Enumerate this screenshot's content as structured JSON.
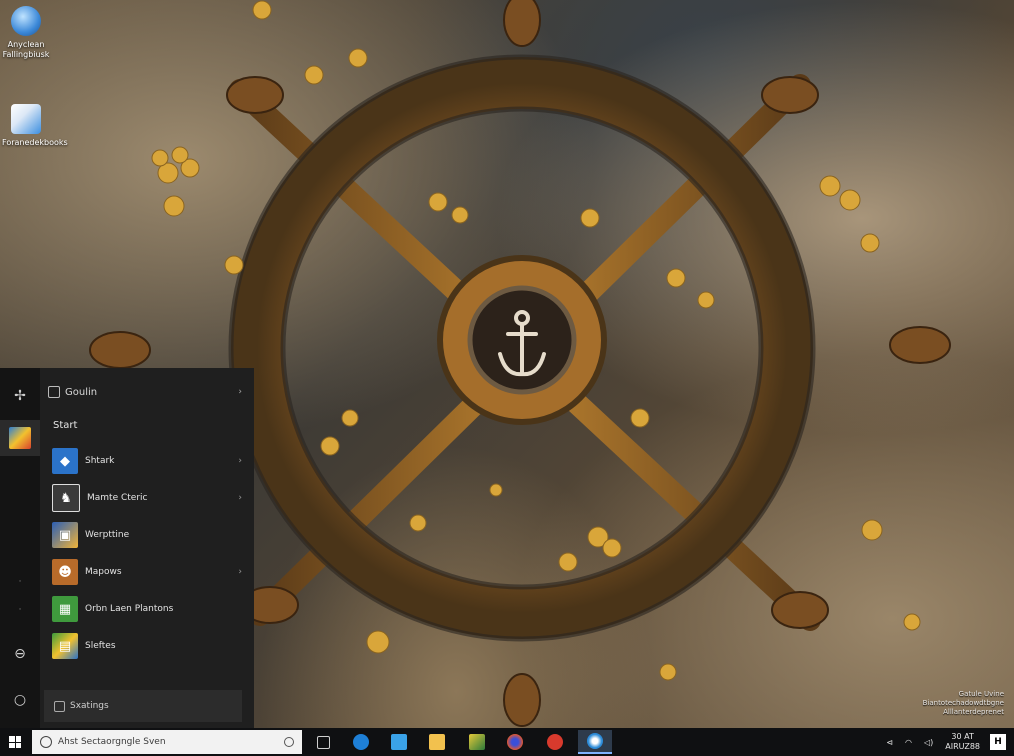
{
  "desktop": {
    "icons": [
      {
        "label_1": "Anyclean",
        "label_2": "Fallingbiusk"
      },
      {
        "label_1": "Foranedekbooks",
        "label_2": ""
      }
    ],
    "watermark": {
      "line_1": "Gatule Uvine",
      "line_2": "Biantotechadowdtbgne",
      "line_3": "Alllanterdeprenet"
    }
  },
  "start_menu": {
    "header": {
      "label": "Goulin",
      "chevron": "›"
    },
    "section_title": "Start",
    "apps": [
      {
        "name": "Shtark",
        "tile_color": "#2b73c9",
        "icon": "app-icon",
        "has_chevron": true
      },
      {
        "name": "Mamte Cteric",
        "tile_color": "#3a3a3a",
        "icon": "app-icon",
        "has_chevron": true
      },
      {
        "name": "Werpttine",
        "tile_color": "#2c5fb5",
        "icon": "app-icon",
        "has_chevron": false
      },
      {
        "name": "Mapows",
        "tile_color": "#b86b2a",
        "icon": "app-icon",
        "has_chevron": true
      },
      {
        "name": "Orbn Laen Plantons",
        "tile_color": "#3f9a3d",
        "icon": "app-icon",
        "has_chevron": false
      },
      {
        "name": "Sleftes",
        "tile_color": "#3a9b3c",
        "icon": "app-icon",
        "has_chevron": false
      }
    ],
    "footer": {
      "label": "Sxatings"
    },
    "rail": {
      "dots": [
        "·",
        "·"
      ]
    }
  },
  "taskbar": {
    "search": {
      "text": "Ahst Sectaorgngle Sven"
    },
    "apps": [
      {
        "name": "task-view",
        "color": "#cfcfcf"
      },
      {
        "name": "edge",
        "color": "#1e7fd6"
      },
      {
        "name": "store",
        "color": "#3aa2e8"
      },
      {
        "name": "file-explorer",
        "color": "#f2c14e"
      },
      {
        "name": "photos",
        "color": "#e5c93a"
      },
      {
        "name": "firefox",
        "color": "#e2582f"
      },
      {
        "name": "red-app",
        "color": "#d83a2d"
      },
      {
        "name": "active-app",
        "color": "#2a8ad8"
      }
    ],
    "tray": {
      "icon_1": "⊲",
      "icon_2": "◠",
      "icon_3": "◁)",
      "time": "30 AT",
      "date": "AIRUZ88",
      "notification": "H"
    }
  }
}
